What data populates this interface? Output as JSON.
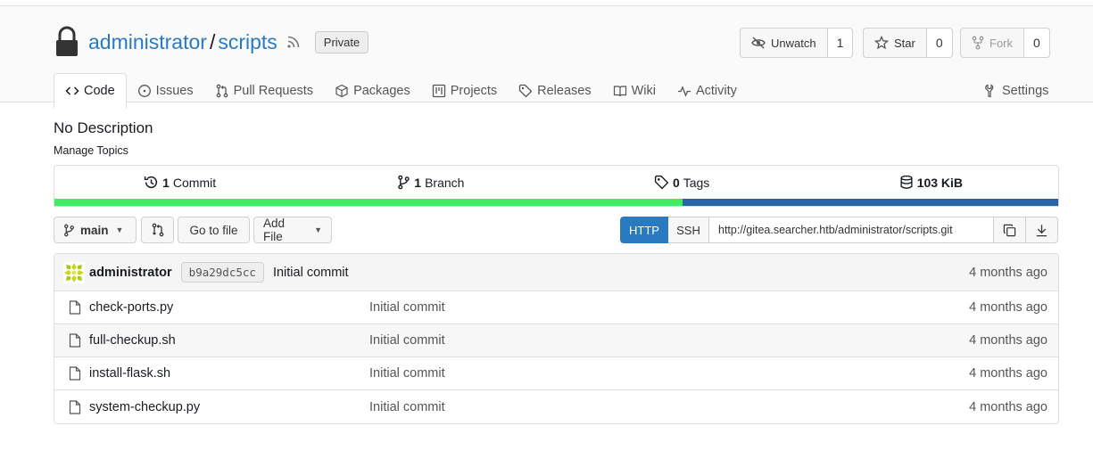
{
  "repo": {
    "owner": "administrator",
    "separator": "/",
    "name": "scripts",
    "visibility": "Private"
  },
  "actions": {
    "watch": {
      "label": "Unwatch",
      "count": "1"
    },
    "star": {
      "label": "Star",
      "count": "0"
    },
    "fork": {
      "label": "Fork",
      "count": "0"
    }
  },
  "tabs": [
    {
      "label": "Code",
      "icon": "code-icon"
    },
    {
      "label": "Issues",
      "icon": "issue-icon"
    },
    {
      "label": "Pull Requests",
      "icon": "pull-request-icon"
    },
    {
      "label": "Packages",
      "icon": "package-icon"
    },
    {
      "label": "Projects",
      "icon": "project-icon"
    },
    {
      "label": "Releases",
      "icon": "tag-icon"
    },
    {
      "label": "Wiki",
      "icon": "book-icon"
    },
    {
      "label": "Activity",
      "icon": "pulse-icon"
    }
  ],
  "settings_label": "Settings",
  "description": "No Description",
  "manage_topics": "Manage Topics",
  "stats": {
    "commits": {
      "count": "1",
      "label": "Commit"
    },
    "branches": {
      "count": "1",
      "label": "Branch"
    },
    "tags": {
      "count": "0",
      "label": "Tags"
    },
    "size": {
      "count": "103 KiB"
    }
  },
  "languages": [
    {
      "color": "#3fef62",
      "fraction": 0.626
    },
    {
      "color": "#2666a8",
      "fraction": 0.374
    }
  ],
  "toolbar": {
    "branch": "main",
    "go_to_file": "Go to file",
    "add_file": "Add File"
  },
  "clone": {
    "http": "HTTP",
    "ssh": "SSH",
    "url": "http://gitea.searcher.htb/administrator/scripts.git"
  },
  "latest_commit": {
    "author": "administrator",
    "sha": "b9a29dc5cc",
    "message": "Initial commit",
    "time": "4 months ago"
  },
  "files": [
    {
      "name": "check-ports.py",
      "commit": "Initial commit",
      "time": "4 months ago"
    },
    {
      "name": "full-checkup.sh",
      "commit": "Initial commit",
      "time": "4 months ago"
    },
    {
      "name": "install-flask.sh",
      "commit": "Initial commit",
      "time": "4 months ago"
    },
    {
      "name": "system-checkup.py",
      "commit": "Initial commit",
      "time": "4 months ago"
    }
  ]
}
